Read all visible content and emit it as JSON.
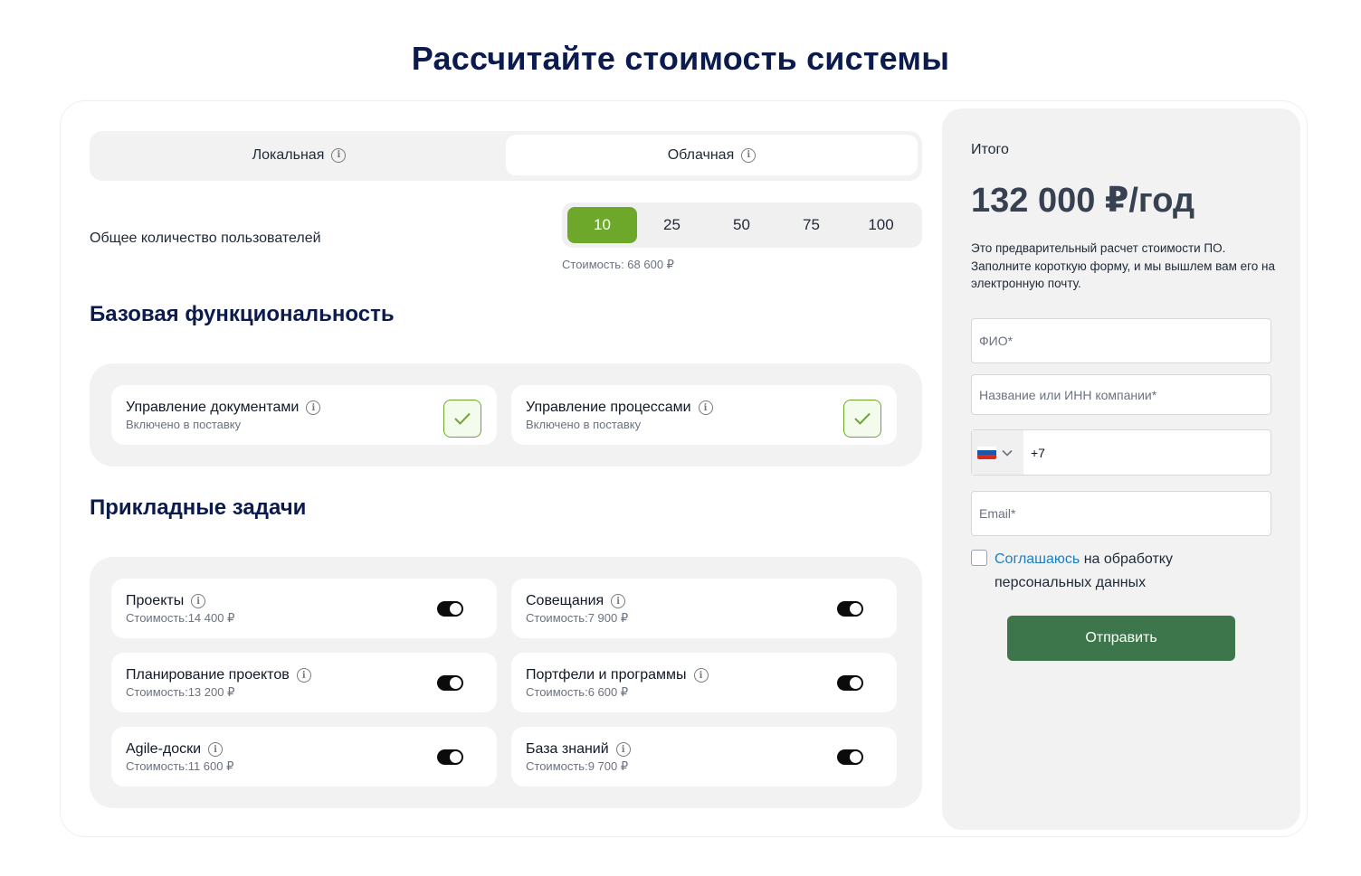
{
  "title": "Рассчитайте стоимость системы",
  "deployment": {
    "local_label": "Локальная",
    "cloud_label": "Облачная",
    "selected": "cloud"
  },
  "users": {
    "label": "Общее количество пользователей",
    "options": [
      "10",
      "25",
      "50",
      "75",
      "100"
    ],
    "selected": "10",
    "cost": "Стоимость: 68 600 ₽"
  },
  "base": {
    "title": "Базовая функциональность",
    "items": [
      {
        "label": "Управление документами",
        "status": "Включено в поставку"
      },
      {
        "label": "Управление процессами",
        "status": "Включено в поставку"
      }
    ]
  },
  "applied": {
    "title": "Прикладные задачи",
    "items": [
      {
        "label": "Проекты",
        "cost": "Стоимость:14 400 ₽",
        "enabled": true
      },
      {
        "label": "Совещания",
        "cost": "Стоимость:7 900 ₽",
        "enabled": true
      },
      {
        "label": "Планирование проектов",
        "cost": "Стоимость:13 200 ₽",
        "enabled": true
      },
      {
        "label": "Портфели и программы",
        "cost": "Стоимость:6 600 ₽",
        "enabled": true
      },
      {
        "label": "Agile-доски",
        "cost": "Стоимость:11 600 ₽",
        "enabled": true
      },
      {
        "label": "База знаний",
        "cost": "Стоимость:9 700 ₽",
        "enabled": true
      }
    ]
  },
  "summary": {
    "label": "Итого",
    "total": "132 000 ₽/год",
    "note": "Это предварительный расчет стоимости ПО. Заполните короткую форму, и мы вышлем вам его на электронную почту."
  },
  "form": {
    "name_placeholder": "ФИО*",
    "company_placeholder": "Название или ИНН компании*",
    "phone_value": "+7",
    "email_placeholder": "Email*",
    "consent_link": "Соглашаюсь",
    "consent_text": " на обработку персональных данных",
    "submit_label": "Отправить"
  },
  "colors": {
    "accent_green": "#6ea82b",
    "submit_green": "#3e764b",
    "title_navy": "#0c1b4d",
    "link_blue": "#1d7fbf"
  },
  "icons": {
    "info": "info-icon",
    "check": "check-icon",
    "toggle": "toggle-switch",
    "flag": "russia-flag-icon",
    "chevron": "chevron-down-icon"
  }
}
